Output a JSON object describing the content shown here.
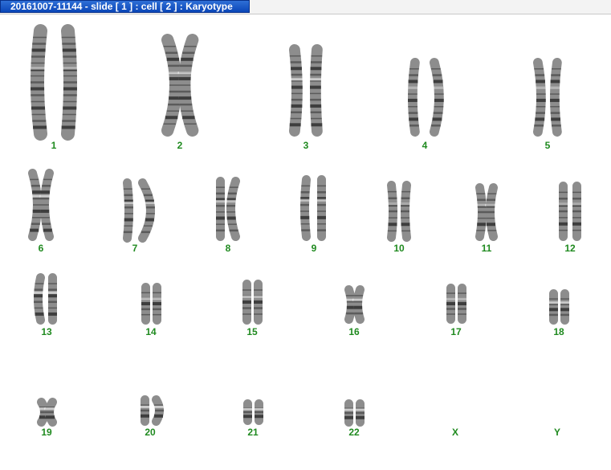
{
  "window": {
    "title": "20161007-11144 - slide [ 1 ] : cell [ 2 ] : Karyotype"
  },
  "karyotype": {
    "label_color": "#1f8a1f",
    "chromosome_color": "#3a3a3a",
    "chromosomes": [
      {
        "label": "1",
        "homologs": 2
      },
      {
        "label": "2",
        "homologs": 2
      },
      {
        "label": "3",
        "homologs": 2
      },
      {
        "label": "4",
        "homologs": 2
      },
      {
        "label": "5",
        "homologs": 2
      },
      {
        "label": "6",
        "homologs": 2
      },
      {
        "label": "7",
        "homologs": 2
      },
      {
        "label": "8",
        "homologs": 2
      },
      {
        "label": "9",
        "homologs": 2
      },
      {
        "label": "10",
        "homologs": 2
      },
      {
        "label": "11",
        "homologs": 2
      },
      {
        "label": "12",
        "homologs": 2
      },
      {
        "label": "13",
        "homologs": 2
      },
      {
        "label": "14",
        "homologs": 2
      },
      {
        "label": "15",
        "homologs": 2
      },
      {
        "label": "16",
        "homologs": 2
      },
      {
        "label": "17",
        "homologs": 2
      },
      {
        "label": "18",
        "homologs": 2
      },
      {
        "label": "19",
        "homologs": 2
      },
      {
        "label": "20",
        "homologs": 2
      },
      {
        "label": "21",
        "homologs": 2
      },
      {
        "label": "22",
        "homologs": 2
      },
      {
        "label": "X",
        "homologs": 0
      },
      {
        "label": "Y",
        "homologs": 0
      }
    ]
  }
}
